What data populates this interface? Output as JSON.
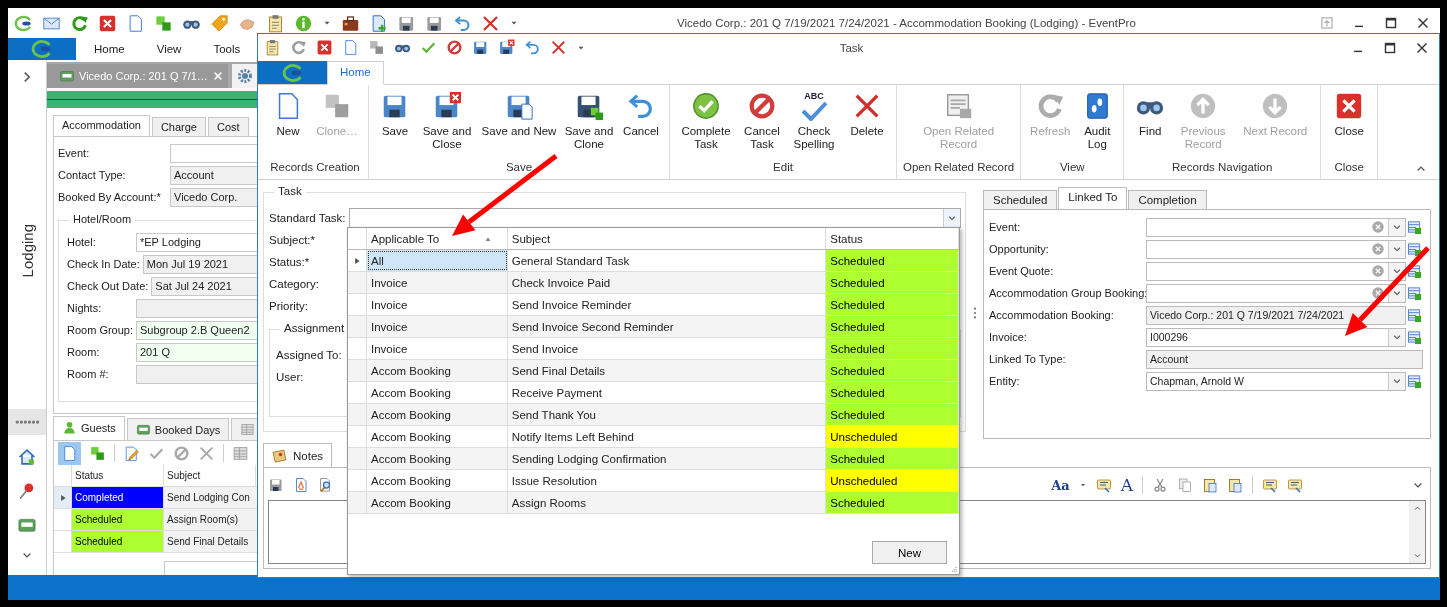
{
  "main_window": {
    "title": "Vicedo Corp.: 201 Q 7/19/2021 7/24/2021  - Accommodation Booking (Lodging) - EventPro",
    "ribbon_tabs": [
      "Home",
      "View",
      "Tools"
    ],
    "sidebar_label": "Lodging",
    "document_tab": "Vicedo Corp.: 201 Q 7/1…",
    "form_tabs": [
      {
        "label": "Accommodation",
        "selected": true
      },
      {
        "label": "Charge",
        "selected": false
      },
      {
        "label": "Cost",
        "selected": false
      }
    ],
    "fields": [
      {
        "label": "Event:",
        "kind": "input"
      },
      {
        "label": "Contact Type:",
        "value": "Account",
        "kind": "readonly"
      },
      {
        "label": "Booked By Account:*",
        "value": "Vicedo Corp.",
        "kind": "readonly"
      }
    ],
    "hotel_room": {
      "title": "Hotel/Room",
      "fields": [
        {
          "label": "Hotel:",
          "value": "*EP Lodging",
          "kind": "input"
        },
        {
          "label": "Check In Date:",
          "value": "Mon Jul 19 2021",
          "kind": "readonly"
        },
        {
          "label": "Check Out Date:",
          "value": "Sat Jul 24 2021",
          "kind": "readonly"
        },
        {
          "label": "Nights:",
          "kind": "readonly"
        },
        {
          "label": "Room Group:",
          "value": "Subgroup 2.B Queen2",
          "kind": "required"
        },
        {
          "label": "Room:",
          "value": "201 Q",
          "kind": "required"
        },
        {
          "label": "Room #:",
          "kind": "readonly"
        }
      ]
    },
    "detail_tabs": [
      {
        "label": "Guests",
        "selected": true
      },
      {
        "label": "Booked Days",
        "selected": false
      }
    ],
    "tasks_grid": {
      "columns": [
        "Status",
        "Subject"
      ],
      "rows": [
        {
          "status": "Completed",
          "subject": "Send Lodging Con",
          "color": "#0000ff",
          "selected": true
        },
        {
          "status": "Scheduled",
          "subject": "Assign Room(s)",
          "color": "#adff2f",
          "selected": false
        },
        {
          "status": "Scheduled",
          "subject": "Send Final Details",
          "color": "#adff2f",
          "selected": false
        }
      ]
    }
  },
  "task_window": {
    "title": "Task",
    "ribbon_tab": "Home",
    "ribbon_groups": [
      {
        "label": "Records Creation",
        "buttons": [
          {
            "label": "New",
            "disabled": false
          },
          {
            "label": "Clone…",
            "disabled": true
          }
        ]
      },
      {
        "label": "Save",
        "buttons": [
          {
            "label": "Save",
            "disabled": false
          },
          {
            "label": "Save and Close",
            "disabled": false
          },
          {
            "label": "Save and New",
            "disabled": false
          },
          {
            "label": "Save and Clone",
            "disabled": false
          },
          {
            "label": "Cancel",
            "disabled": false
          }
        ]
      },
      {
        "label": "Edit",
        "buttons": [
          {
            "label": "Complete Task",
            "disabled": false
          },
          {
            "label": "Cancel Task",
            "disabled": false
          },
          {
            "label": "Check Spelling",
            "disabled": false,
            "icon_text": "ABC"
          },
          {
            "label": "Delete",
            "disabled": false
          }
        ]
      },
      {
        "label": "Open Related Record",
        "buttons": [
          {
            "label": "Open Related Record",
            "disabled": true
          }
        ]
      },
      {
        "label": "View",
        "buttons": [
          {
            "label": "Refresh",
            "disabled": true
          },
          {
            "label": "Audit Log",
            "disabled": false
          }
        ]
      },
      {
        "label": "Records Navigation",
        "buttons": [
          {
            "label": "Find",
            "disabled": false
          },
          {
            "label": "Previous Record",
            "disabled": true
          },
          {
            "label": "Next Record",
            "disabled": true
          }
        ]
      },
      {
        "label": "Close",
        "buttons": [
          {
            "label": "Close",
            "disabled": false
          }
        ]
      }
    ],
    "task_group": {
      "title": "Task",
      "labels": [
        "Standard Task:",
        "Subject:*",
        "Status:*",
        "Category:",
        "Priority:"
      ]
    },
    "assignment": {
      "title": "Assignment",
      "labels": [
        "Assigned To:",
        "User:"
      ]
    },
    "standard_task_dropdown": {
      "columns": [
        {
          "label": "Applicable To",
          "sorted": true
        },
        {
          "label": "Subject",
          "sorted": false
        },
        {
          "label": "Status",
          "sorted": false
        }
      ],
      "rows": [
        {
          "applicable_to": "All",
          "subject": "General Standard Task",
          "status": "Scheduled",
          "color": "#adff2f",
          "selected": true
        },
        {
          "applicable_to": "Invoice",
          "subject": "Check Invoice Paid",
          "status": "Scheduled",
          "color": "#adff2f",
          "selected": false
        },
        {
          "applicable_to": "Invoice",
          "subject": "Send Invoice Reminder",
          "status": "Scheduled",
          "color": "#adff2f",
          "selected": false
        },
        {
          "applicable_to": "Invoice",
          "subject": "Send Invoice Second Reminder",
          "status": "Scheduled",
          "color": "#adff2f",
          "selected": false
        },
        {
          "applicable_to": "Invoice",
          "subject": "Send Invoice",
          "status": "Scheduled",
          "color": "#adff2f",
          "selected": false
        },
        {
          "applicable_to": "Accom Booking",
          "subject": "Send Final Details",
          "status": "Scheduled",
          "color": "#adff2f",
          "selected": false
        },
        {
          "applicable_to": "Accom Booking",
          "subject": "Receive Payment",
          "status": "Scheduled",
          "color": "#adff2f",
          "selected": false
        },
        {
          "applicable_to": "Accom Booking",
          "subject": "Send Thank You",
          "status": "Scheduled",
          "color": "#adff2f",
          "selected": false
        },
        {
          "applicable_to": "Accom Booking",
          "subject": "Notify Items Left Behind",
          "status": "Unscheduled",
          "color": "#ffff00",
          "selected": false
        },
        {
          "applicable_to": "Accom Booking",
          "subject": "Sending Lodging Confirmation",
          "status": "Scheduled",
          "color": "#adff2f",
          "selected": false
        },
        {
          "applicable_to": "Accom Booking",
          "subject": "Issue Resolution",
          "status": "Unscheduled",
          "color": "#ffff00",
          "selected": false
        },
        {
          "applicable_to": "Accom Booking",
          "subject": "Assign Rooms",
          "status": "Scheduled",
          "color": "#adff2f",
          "selected": false
        }
      ],
      "new_button": "New"
    },
    "link_tabs": [
      {
        "label": "Scheduled",
        "selected": false
      },
      {
        "label": "Linked To",
        "selected": true
      },
      {
        "label": "Completion",
        "selected": false
      }
    ],
    "link_fields": [
      {
        "label": "Event:",
        "kind": "clearable"
      },
      {
        "label": "Opportunity:",
        "kind": "clearable"
      },
      {
        "label": "Event Quote:",
        "kind": "clearable"
      },
      {
        "label": "Accommodation Group Booking:",
        "kind": "clearable"
      },
      {
        "label": "Accommodation Booking:",
        "value": "Vicedo Corp.: 201 Q 7/19/2021 7/24/2021",
        "kind": "lookup"
      },
      {
        "label": "Invoice:",
        "value": "I000296",
        "kind": "dropdown"
      },
      {
        "label": "Linked To Type:",
        "value": "Account",
        "kind": "readonly"
      },
      {
        "label": "Entity:",
        "value": "Chapman, Arnold W",
        "kind": "dropdown"
      }
    ],
    "notes_tab": "Notes",
    "notes_toolbar": {
      "font_glyph": "Aa",
      "color_glyph": "A"
    }
  }
}
